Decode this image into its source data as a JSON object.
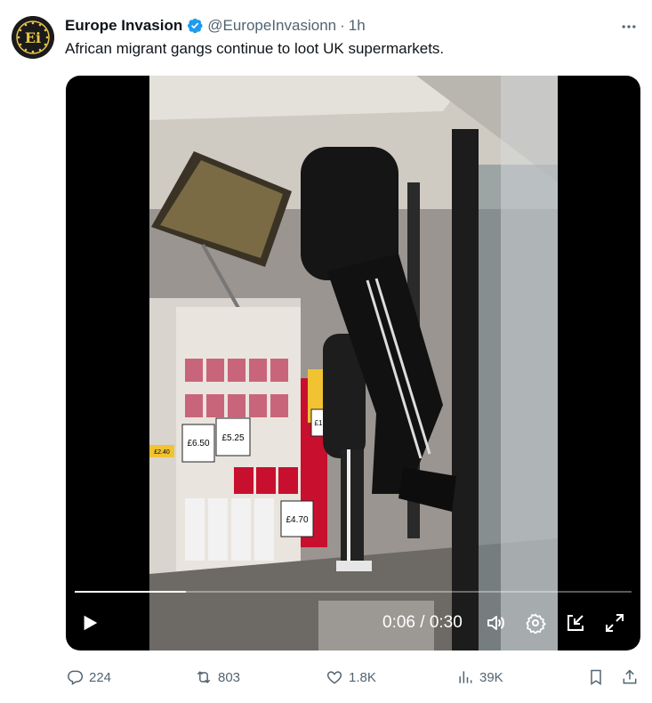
{
  "author": {
    "name": "Europe Invasion",
    "handle": "@EuropeInvasionn",
    "separator": "·",
    "time": "1h",
    "avatar_text": "Ei",
    "verified_color": "#1d9bf0"
  },
  "tweet": {
    "text": "African migrant gangs continue to loot UK supermarkets."
  },
  "video": {
    "current_time": "0:06",
    "separator": "/",
    "duration": "0:30",
    "progress_fraction": 0.2,
    "price_labels": [
      "£6.50",
      "£5.25",
      "£4.70",
      "£2.40",
      "£1"
    ]
  },
  "actions": {
    "replies": "224",
    "retweets": "803",
    "likes": "1.8K",
    "views": "39K"
  },
  "colors": {
    "muted": "#536471",
    "text": "#0f1419",
    "accent": "#1d9bf0"
  },
  "icons": {
    "more": "more-horizontal-icon",
    "play": "play-icon",
    "volume": "volume-icon",
    "settings": "gear-icon",
    "pip": "picture-in-picture-icon",
    "fullscreen": "fullscreen-icon",
    "reply": "reply-icon",
    "retweet": "retweet-icon",
    "like": "heart-icon",
    "views": "bar-chart-icon",
    "bookmark": "bookmark-icon",
    "share": "share-icon"
  }
}
